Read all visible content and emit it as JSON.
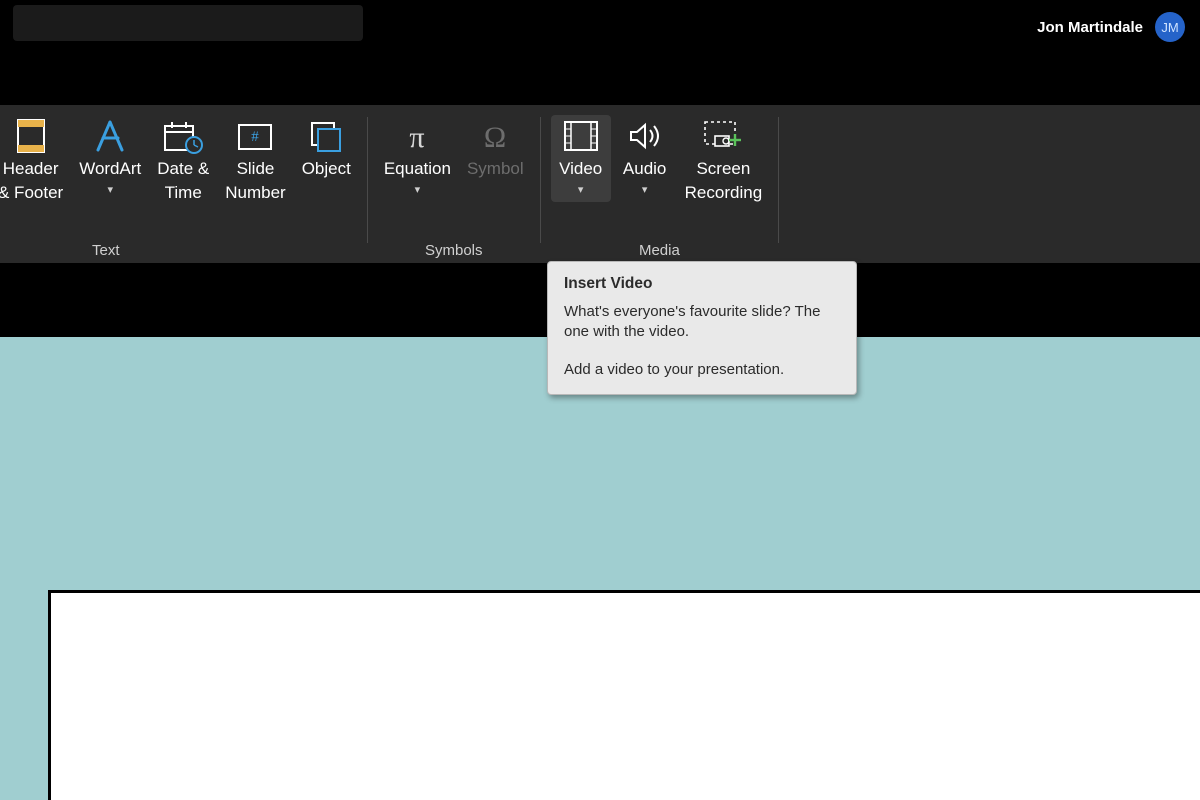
{
  "user": {
    "name": "Jon Martindale",
    "initials": "JM"
  },
  "ribbon": {
    "text_group": {
      "label": "Text",
      "header_footer": "Header\n& Footer",
      "wordart": "WordArt",
      "date_time": "Date &\nTime",
      "slide_number": "Slide\nNumber",
      "object": "Object"
    },
    "symbols_group": {
      "label": "Symbols",
      "equation": "Equation",
      "symbol": "Symbol"
    },
    "media_group": {
      "label": "Media",
      "video": "Video",
      "audio": "Audio",
      "screen_recording": "Screen\nRecording"
    }
  },
  "tooltip": {
    "title": "Insert Video",
    "body1": "What's everyone's favourite slide? The one with the video.",
    "body2": "Add a video to your presentation."
  }
}
